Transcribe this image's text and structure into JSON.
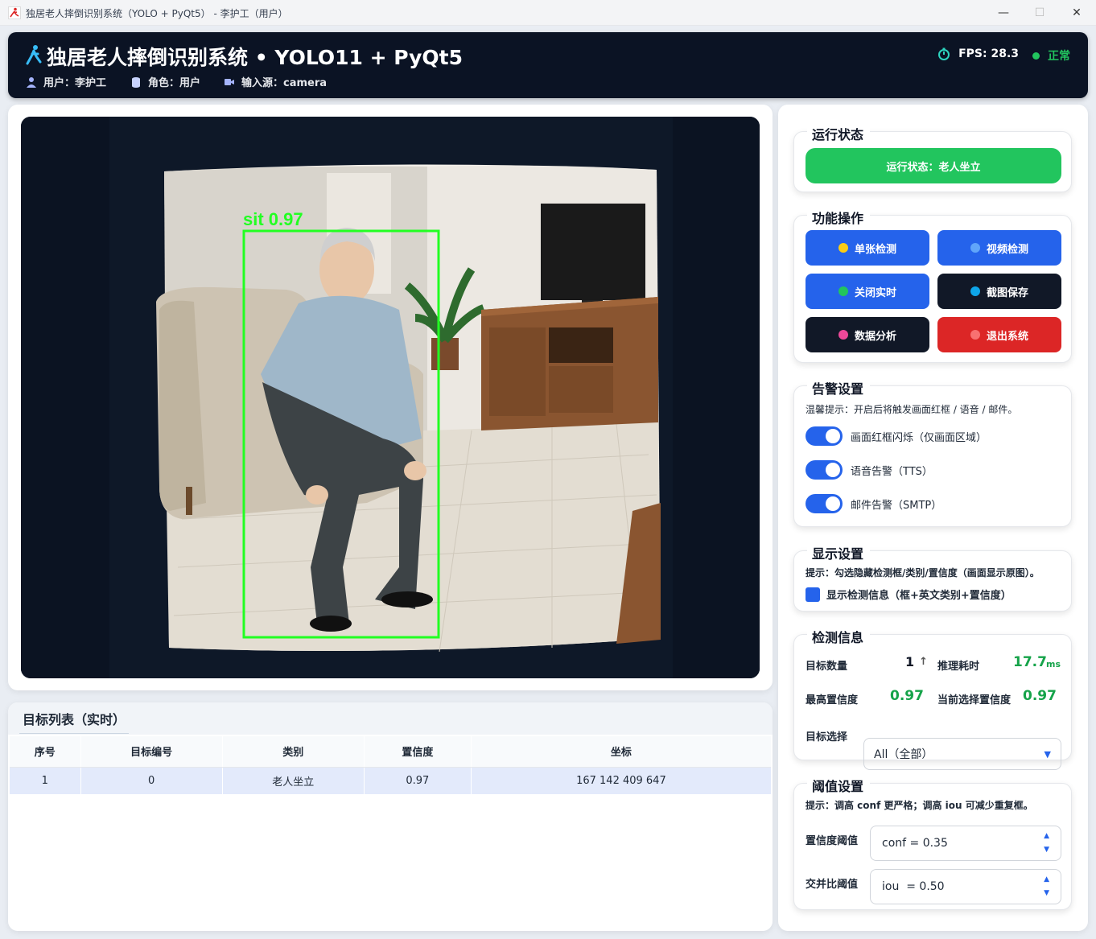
{
  "window": {
    "title": "独居老人摔倒识别系统（YOLO + PyQt5） - 李护工（用户）",
    "minimize": "—",
    "maximize": "☐",
    "close": "✕"
  },
  "header": {
    "title": "独居老人摔倒识别系统 • YOLO11 + PyQt5",
    "user": "用户：李护工",
    "role": "角色：用户",
    "source": "输入源：camera",
    "fps": "FPS: 28.3",
    "status": "正常"
  },
  "video": {
    "detection_label": "sit 0.97",
    "box_color": "#22ff22"
  },
  "target_list": {
    "title": "目标列表（实时）",
    "columns": [
      "序号",
      "目标编号",
      "类别",
      "置信度",
      "坐标"
    ],
    "rows": [
      [
        "1",
        "0",
        "老人坐立",
        "0.97",
        "167 142 409 647"
      ]
    ]
  },
  "run_status": {
    "title": "运行状态",
    "text": "运行状态：老人坐立",
    "color": "#22c55e"
  },
  "functions": {
    "title": "功能操作",
    "buttons": [
      {
        "label": "单张检测",
        "dot": "#facc15"
      },
      {
        "label": "视频检测",
        "dot": "#60a5fa"
      },
      {
        "label": "关闭实时",
        "dot": "#22c55e"
      },
      {
        "label": "截图保存",
        "dot": "#0ea5e9"
      },
      {
        "label": "数据分析",
        "dot": "#ec4899"
      },
      {
        "label": "退出系统",
        "dot": "#f87171"
      }
    ]
  },
  "alarm": {
    "title": "告警设置",
    "hint": "温馨提示：开启后将触发画面红框 / 语音 / 邮件。",
    "toggles": [
      {
        "label": "画面红框闪烁（仅画面区域）",
        "on": true
      },
      {
        "label": "语音告警（TTS）",
        "on": true
      },
      {
        "label": "邮件告警（SMTP）",
        "on": true
      }
    ]
  },
  "display": {
    "title": "显示设置",
    "hint": "提示：勾选隐藏检测框/类别/置信度（画面显示原图）。",
    "checkbox_label": "显示检测信息（框+英文类别+置信度）",
    "checked": true
  },
  "detection_info": {
    "title": "检测信息",
    "count_label": "目标数量",
    "count_value": "1",
    "infer_label": "推理耗时",
    "infer_value": "17.7",
    "infer_unit": "ms",
    "max_conf_label": "最高置信度",
    "max_conf_value": "0.97",
    "cur_conf_label": "当前选择置信度",
    "cur_conf_value": "0.97",
    "select_label": "目标选择",
    "select_value": "All（全部）"
  },
  "threshold": {
    "title": "阈值设置",
    "hint": "提示：调高 conf 更严格；调高 iou 可减少重复框。",
    "conf_label": "置信度阈值",
    "conf_value": "conf = 0.35",
    "iou_label": "交并比阈值",
    "iou_value": "iou  = 0.50"
  }
}
